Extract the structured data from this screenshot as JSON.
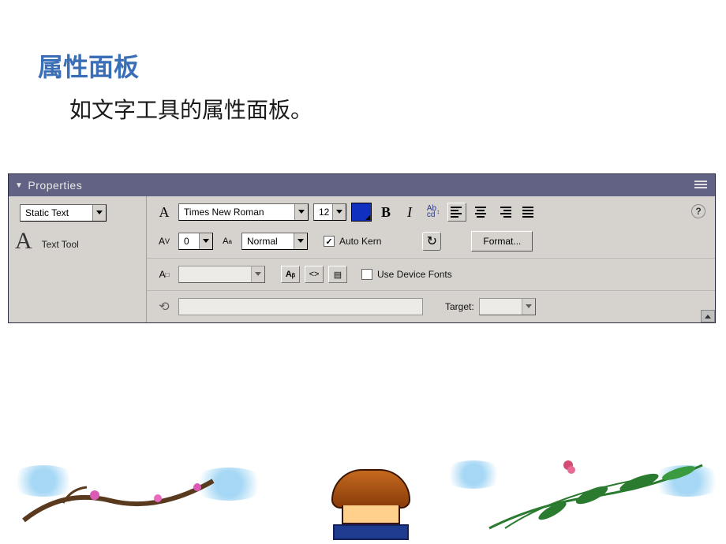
{
  "slide": {
    "title": "属性面板",
    "subtitle": "如文字工具的属性面板。"
  },
  "panel": {
    "header": "Properties",
    "textType": "Static Text",
    "toolLabel": "Text Tool",
    "font": "Times New Roman",
    "fontSize": "12",
    "color": "#1030c0",
    "charSpacing": "0",
    "charPos": "Normal",
    "autoKernLabel": "Auto Kern",
    "autoKernChecked": true,
    "formatBtn": "Format...",
    "lineType": "",
    "useDeviceFontsLabel": "Use Device Fonts",
    "useDeviceFontsChecked": false,
    "url": "",
    "targetLabel": "Target:",
    "target": ""
  }
}
